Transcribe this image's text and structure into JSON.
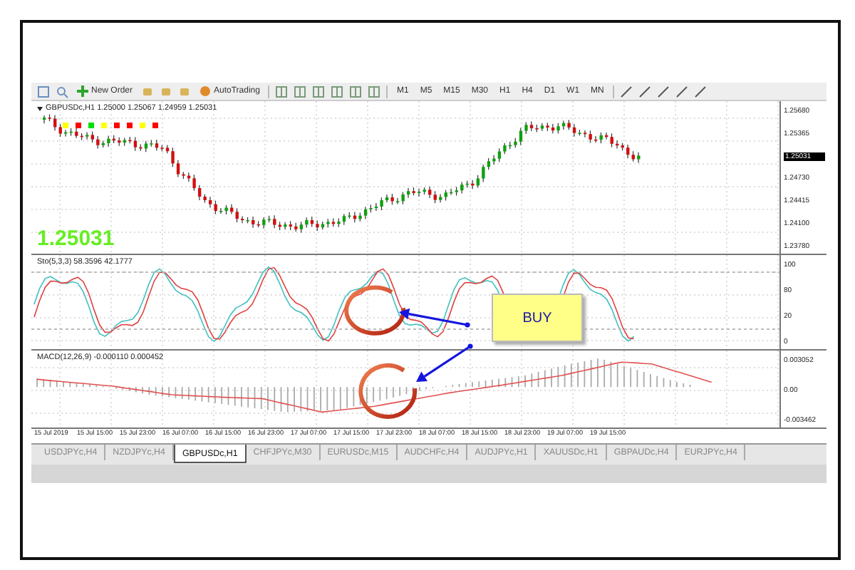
{
  "toolbar": {
    "buttons": [
      {
        "kind": "new-order",
        "label": "New Order"
      },
      {
        "kind": "autotrading",
        "label": "AutoTrading"
      }
    ],
    "timeframes": [
      "M1",
      "M5",
      "M15",
      "M30",
      "H1",
      "H4",
      "D1",
      "W1",
      "MN"
    ]
  },
  "chart": {
    "header": "GBPUSDc,H1  1.25000 1.25067 1.24959 1.25031",
    "price": "1.25031",
    "signals": [
      {
        "color": "#ffff00"
      },
      {
        "color": "#ff0000"
      },
      {
        "color": "#00e000"
      },
      {
        "color": "#ffff00"
      },
      {
        "color": "#ff0000"
      },
      {
        "color": "#ff0000"
      },
      {
        "color": "#ffff00"
      },
      {
        "color": "#ff0000"
      }
    ],
    "price_scale": [
      {
        "text": "1.25680",
        "current": false
      },
      {
        "text": "1.25365",
        "current": false
      },
      {
        "text": "1.25031",
        "current": true
      },
      {
        "text": "1.24730",
        "current": false
      },
      {
        "text": "1.24415",
        "current": false
      },
      {
        "text": "1.24100",
        "current": false
      },
      {
        "text": "1.23780",
        "current": false
      }
    ],
    "indicators": [
      {
        "kind": "stochastic",
        "label": "Sto(5,3,3) 58.3596 42.1777",
        "scale": [
          "100",
          "80",
          "20",
          "0"
        ]
      },
      {
        "kind": "macd",
        "label": "MACD(12,26,9) -0.000110 0.000452",
        "scale": [
          "0.003052",
          "0.00",
          "-0.003462"
        ]
      }
    ],
    "time_axis": [
      "15 Jul 2019",
      "15 Jul 15:00",
      "15 Jul 23:00",
      "16 Jul 07:00",
      "16 Jul 15:00",
      "16 Jul 23:00",
      "17 Jul 07:00",
      "17 Jul 15:00",
      "17 Jul 23:00",
      "18 Jul 07:00",
      "18 Jul 15:00",
      "18 Jul 23:00",
      "19 Jul 07:00",
      "19 Jul 15:00"
    ],
    "annotation": {
      "label": "BUY"
    }
  },
  "tabs": [
    {
      "label": "USDJPYc,H4",
      "selected": false
    },
    {
      "label": "NZDJPYc,H4",
      "selected": false
    },
    {
      "label": "GBPUSDc,H1",
      "selected": true
    },
    {
      "label": "CHFJPYc,M30",
      "selected": false
    },
    {
      "label": "EURUSDc,M15",
      "selected": false
    },
    {
      "label": "AUDCHFc,H4",
      "selected": false
    },
    {
      "label": "AUDJPYc,H1",
      "selected": false
    },
    {
      "label": "XAUUSDc,H1",
      "selected": false
    },
    {
      "label": "GBPAUDc,H4",
      "selected": false
    },
    {
      "label": "EURJPYc,H4",
      "selected": false
    }
  ]
}
